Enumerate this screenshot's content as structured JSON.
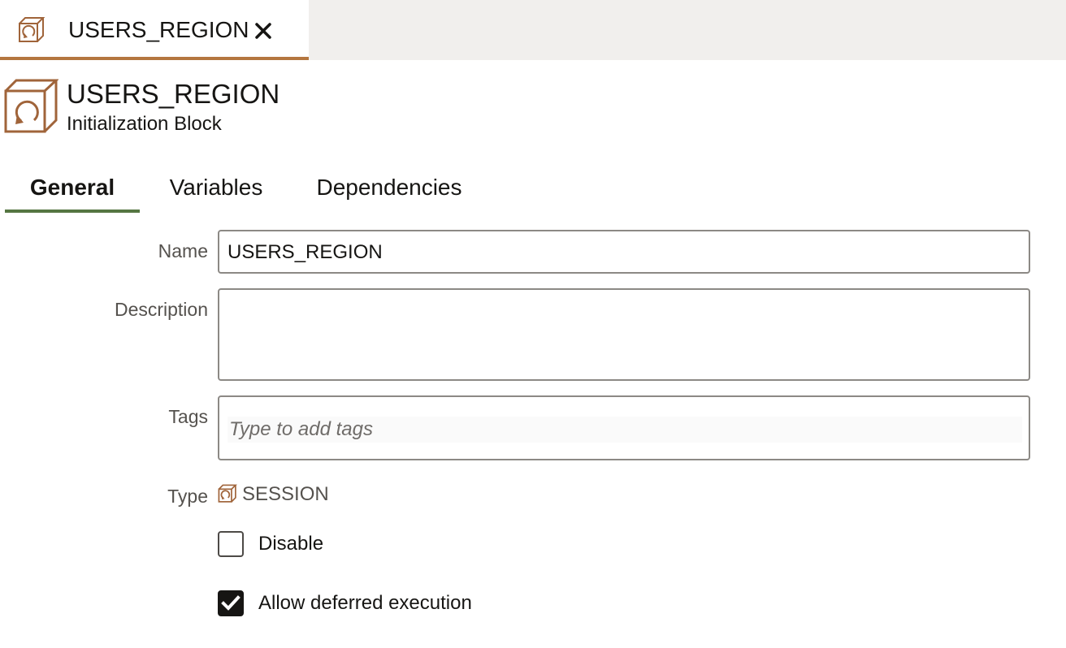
{
  "document_tab": {
    "title": "USERS_REGION",
    "icon": "initialization-block-icon",
    "close_icon": "close-icon"
  },
  "header": {
    "title": "USERS_REGION",
    "subtitle": "Initialization Block",
    "icon": "initialization-block-icon"
  },
  "tabs": [
    {
      "label": "General",
      "active": true
    },
    {
      "label": "Variables",
      "active": false
    },
    {
      "label": "Dependencies",
      "active": false
    }
  ],
  "form": {
    "name": {
      "label": "Name",
      "value": "USERS_REGION"
    },
    "description": {
      "label": "Description",
      "value": ""
    },
    "tags": {
      "label": "Tags",
      "placeholder": "Type to add tags"
    },
    "type": {
      "label": "Type",
      "value": "SESSION",
      "icon": "initialization-block-icon"
    },
    "disable": {
      "label": "Disable",
      "checked": false
    },
    "allow_deferred": {
      "label": "Allow deferred execution",
      "checked": true
    }
  },
  "colors": {
    "accent_tab": "#b4763f",
    "active_tab_underline": "#557642",
    "icon_brown": "#a0643a",
    "tabbar_bg": "#f1efed"
  }
}
